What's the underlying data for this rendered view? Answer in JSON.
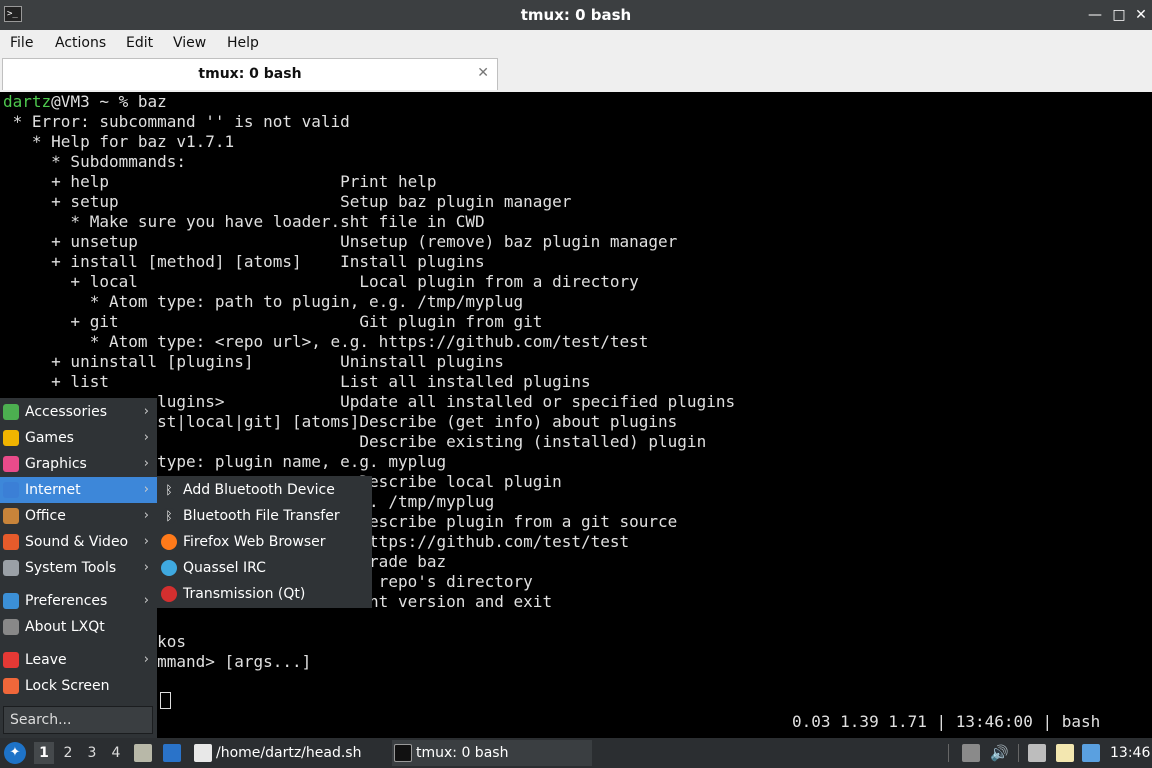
{
  "window": {
    "title": "tmux: 0 bash",
    "app_icon": ">_",
    "min_glyph": "—",
    "max_glyph": "□",
    "close_glyph": "✕"
  },
  "menubar": {
    "file": "File",
    "actions": "Actions",
    "edit": "Edit",
    "view": "View",
    "help": "Help"
  },
  "tab": {
    "label": "tmux: 0 bash",
    "close_glyph": "✕"
  },
  "terminal": {
    "prompt_user": "dartz",
    "prompt_rest": "@VM3 ~ % baz",
    "lines": [
      " * Error: subcommand '' is not valid",
      "   * Help for baz v1.7.1",
      "     * Subdommands:",
      "     + help                        Print help",
      "     + setup                       Setup baz plugin manager",
      "       * Make sure you have loader.sht file in CWD",
      "     + unsetup                     Unsetup (remove) baz plugin manager",
      "     + install [method] [atoms]    Install plugins",
      "       + local                       Local plugin from a directory",
      "         * Atom type: path to plugin, e.g. /tmp/myplug",
      "       + git                         Git plugin from git",
      "         * Atom type: <repo url>, e.g. https://github.com/test/test",
      "     + uninstall [plugins]         Uninstall plugins",
      "     + list                        List all installed plugins",
      "               plugins>            Update all installed or specified plugins",
      "               ist|local|git] [atoms]Describe (get info) about plugins",
      "                                     Describe existing (installed) plugin",
      "                type: plugin name, e.g. myplug",
      "                                     Describe local plugin",
      "                                   e.g. /tmp/myplug",
      "                                     Describe plugin from a git source",
      "                                   . https://github.com/test/test",
      "                                   Upgrade baz",
      "                                   git repo's directory",
      "                                   Print version and exit",
      "",
      "                kos",
      "               ommand> [args...]"
    ],
    "status_bar": "0.03 1.39 1.71 | 13:46:00 | bash"
  },
  "start_menu": {
    "items": [
      {
        "label": "Accessories",
        "arrow": "›",
        "color": "#4caf50"
      },
      {
        "label": "Games",
        "arrow": "›",
        "color": "#f0b400"
      },
      {
        "label": "Graphics",
        "arrow": "›",
        "color": "#e94b8a"
      },
      {
        "label": "Internet",
        "arrow": "›",
        "color": "#3b7fd6"
      },
      {
        "label": "Office",
        "arrow": "›",
        "color": "#c8843a"
      },
      {
        "label": "Sound & Video",
        "arrow": "›",
        "color": "#e65b2b"
      },
      {
        "label": "System Tools",
        "arrow": "›",
        "color": "#9aa0a6"
      },
      {
        "label": "Preferences",
        "arrow": "›",
        "color": "#3b8fd6"
      },
      {
        "label": "About LXQt",
        "arrow": "",
        "color": "#888888"
      },
      {
        "label": "Leave",
        "arrow": "›",
        "color": "#e53935"
      },
      {
        "label": "Lock Screen",
        "arrow": "",
        "color": "#f0673a"
      }
    ],
    "search_placeholder": "Search..."
  },
  "internet_submenu": {
    "items": [
      {
        "label": "Add Bluetooth Device",
        "glyph": "ᛒ",
        "color": "#2f3336"
      },
      {
        "label": "Bluetooth File Transfer",
        "glyph": "ᛒ",
        "color": "#2f3336"
      },
      {
        "label": "Firefox Web Browser",
        "glyph": "",
        "color": "#ff7a1a"
      },
      {
        "label": "Quassel IRC",
        "glyph": "",
        "color": "#3fa9e0"
      },
      {
        "label": "Transmission (Qt)",
        "glyph": "",
        "color": "#d32f2f"
      }
    ]
  },
  "taskbar": {
    "desktops": [
      "1",
      "2",
      "3",
      "4"
    ],
    "tasks": [
      {
        "label": "/home/dartz/head.sh"
      },
      {
        "label": "tmux: 0 bash"
      }
    ],
    "clock": "13:46"
  }
}
